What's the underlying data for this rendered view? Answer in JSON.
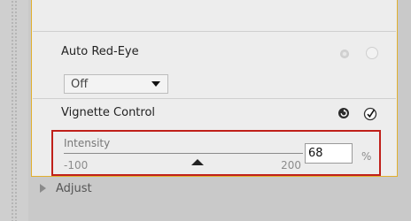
{
  "auto_red_eye": {
    "label": "Auto Red-Eye",
    "mode_value": "Off"
  },
  "vignette": {
    "label": "Vignette Control",
    "intensity": {
      "label": "Intensity",
      "min_label": "-100",
      "max_label": "200",
      "min": -100,
      "max": 200,
      "value": "68",
      "unit": "%"
    }
  },
  "adjust": {
    "label": "Adjust"
  },
  "colors": {
    "panel_border": "#e1b02e",
    "highlight_border": "#c0201a"
  },
  "icons": [
    "dot-icon",
    "radio-ring-icon",
    "reset-icon",
    "check-icon",
    "dropdown-arrow-icon",
    "expand-triangle-icon"
  ]
}
